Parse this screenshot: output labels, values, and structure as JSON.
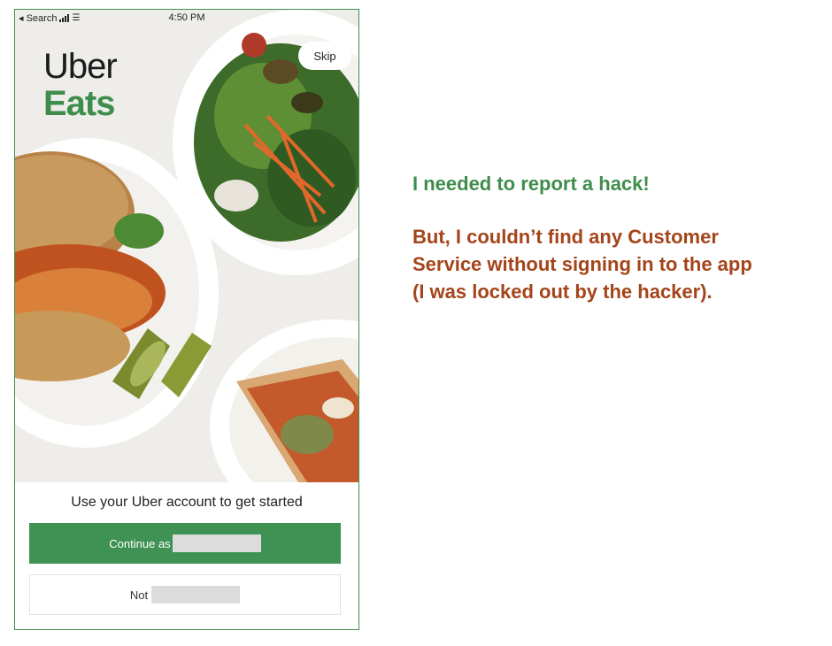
{
  "status_bar": {
    "back_label": "◂ Search",
    "time": "4:50 PM"
  },
  "app": {
    "logo_line1": "Uber",
    "logo_line2": "Eats",
    "skip_label": "Skip",
    "prompt": "Use your Uber account to get started",
    "continue_label": "Continue as",
    "not_label": "Not"
  },
  "annotation": {
    "line1": "I needed to report a hack!",
    "line2": "But, I couldn’t find any Customer",
    "line3": "Service without signing in to the app",
    "line4": "(I was locked out by the hacker)."
  },
  "colors": {
    "brand_green": "#3e8d4c",
    "button_green": "#3f9254",
    "annotation_red": "#a4441a"
  }
}
